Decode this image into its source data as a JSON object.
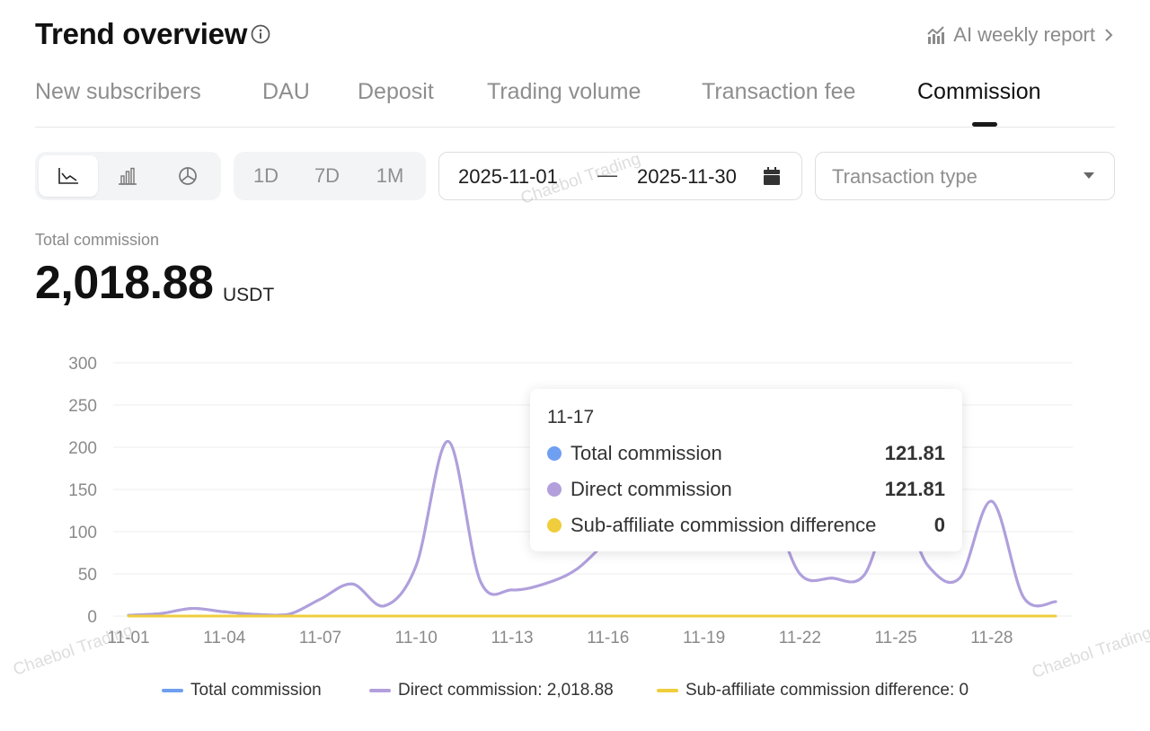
{
  "header": {
    "title": "Trend overview",
    "info_icon": "info-circle-icon",
    "weekly_report_icon": "chart-bars-icon",
    "weekly_report_label": "AI weekly report",
    "chevron_icon": "chevron-right-icon"
  },
  "tabs": [
    {
      "label": "New subscribers",
      "active": false
    },
    {
      "label": "DAU",
      "active": false
    },
    {
      "label": "Deposit",
      "active": false
    },
    {
      "label": "Trading volume",
      "active": false
    },
    {
      "label": "Transaction fee",
      "active": false
    },
    {
      "label": "Commission",
      "active": true
    }
  ],
  "toolbar": {
    "chart_types": [
      {
        "icon": "line-chart-icon",
        "active": true
      },
      {
        "icon": "bar-chart-icon",
        "active": false
      },
      {
        "icon": "pie-chart-icon",
        "active": false
      }
    ],
    "ranges": [
      "1D",
      "7D",
      "1M"
    ],
    "date_start": "2025-11-01",
    "date_separator": "—",
    "date_end": "2025-11-30",
    "calendar_icon": "calendar-icon",
    "transaction_type_placeholder": "Transaction type",
    "dropdown_icon": "caret-down-icon"
  },
  "summary": {
    "label": "Total commission",
    "value": "2,018.88",
    "unit": "USDT"
  },
  "tooltip": {
    "date": "11-17",
    "rows": [
      {
        "name": "Total commission",
        "value": "121.81",
        "color": "#6f9ff0"
      },
      {
        "name": "Direct commission",
        "value": "121.81",
        "color": "#b29fdb"
      },
      {
        "name": "Sub-affiliate commission difference",
        "value": "0",
        "color": "#f0cd3c"
      }
    ]
  },
  "legend": [
    {
      "label": "Total commission",
      "color": "#6f9ff0"
    },
    {
      "label": "Direct commission: 2,018.88",
      "color": "#b29fdb"
    },
    {
      "label": "Sub-affiliate commission difference: 0",
      "color": "#f0cd3c"
    }
  ],
  "watermark": "Chaebol Trading",
  "chart_data": {
    "type": "line",
    "x": [
      "11-01",
      "11-02",
      "11-03",
      "11-04",
      "11-05",
      "11-06",
      "11-07",
      "11-08",
      "11-09",
      "11-10",
      "11-11",
      "11-12",
      "11-13",
      "11-14",
      "11-15",
      "11-16",
      "11-17",
      "11-18",
      "11-19",
      "11-20",
      "11-21",
      "11-22",
      "11-23",
      "11-24",
      "11-25",
      "11-26",
      "11-27",
      "11-28",
      "11-29",
      "11-30"
    ],
    "x_tick_labels": [
      "11-01",
      "11-04",
      "11-07",
      "11-10",
      "11-13",
      "11-16",
      "11-19",
      "11-22",
      "11-25",
      "11-28"
    ],
    "y_ticks": [
      0,
      50,
      100,
      150,
      200,
      250,
      300
    ],
    "ylim": [
      0,
      300
    ],
    "grid": true,
    "legend_position": "bottom",
    "series": [
      {
        "name": "Total commission",
        "color": "#6f9ff0",
        "values": [
          1,
          3,
          9,
          5,
          2,
          2,
          20,
          38,
          12,
          60,
          207,
          42,
          31,
          38,
          55,
          90,
          121.81,
          130,
          128,
          140,
          135,
          50,
          45,
          48,
          135,
          60,
          45,
          136,
          22,
          17
        ]
      },
      {
        "name": "Direct commission",
        "color": "#b29fdb",
        "values": [
          1,
          3,
          9,
          5,
          2,
          2,
          20,
          38,
          12,
          60,
          207,
          42,
          31,
          38,
          55,
          90,
          121.81,
          130,
          128,
          140,
          135,
          50,
          45,
          48,
          135,
          60,
          45,
          136,
          22,
          17
        ]
      },
      {
        "name": "Sub-affiliate commission difference",
        "color": "#f0cd3c",
        "values": [
          0,
          0,
          0,
          0,
          0,
          0,
          0,
          0,
          0,
          0,
          0,
          0,
          0,
          0,
          0,
          0,
          0,
          0,
          0,
          0,
          0,
          0,
          0,
          0,
          0,
          0,
          0,
          0,
          0,
          0
        ]
      }
    ]
  }
}
